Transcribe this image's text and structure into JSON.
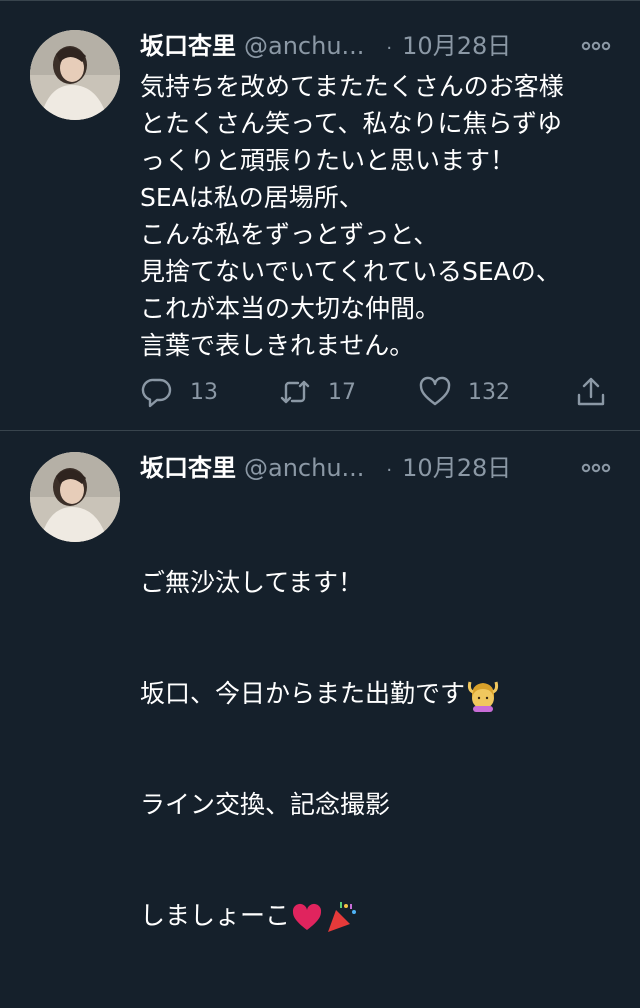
{
  "tweets": [
    {
      "name": "坂口杏里",
      "handle": "@anchu...",
      "separator": "·",
      "date": "10月28日",
      "text": "気持ちを改めてまたたくさんのお客様\nとたくさん笑って、私なりに焦らずゆ\nっくりと頑張りたいと思います！\nSEAは私の居場所、\nこんな私をずっとずっと、\n見捨てないでいてくれているSEAの、\nこれが本当の大切な仲間。\n言葉で表しきれません。",
      "replies": "13",
      "retweets": "17",
      "likes": "132"
    },
    {
      "name": "坂口杏里",
      "handle": "@anchu...",
      "separator": "·",
      "date": "10月28日",
      "line1": "ご無沙汰してます！",
      "line2": "坂口、今日からまた出勤です",
      "line3": "ライン交換、記念撮影",
      "line4": "しましょーこ"
    }
  ],
  "icons": {
    "reply": "reply-icon",
    "retweet": "retweet-icon",
    "like": "heart-icon",
    "share": "share-icon",
    "more": "more-icon"
  },
  "colors": {
    "background": "#15202b",
    "secondary_text": "#8b98a5",
    "divider": "#38444d"
  }
}
